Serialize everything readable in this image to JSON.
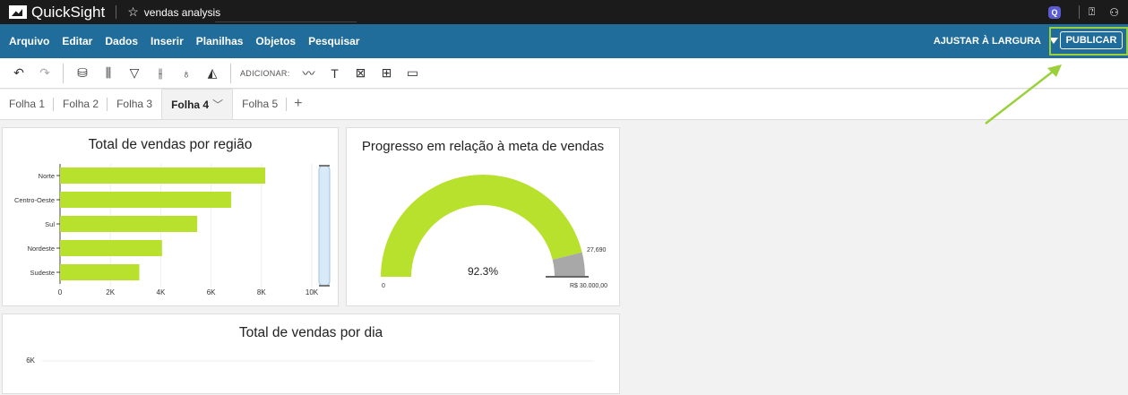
{
  "topbar": {
    "app_name": "QuickSight",
    "analysis_title": "vendas analysis",
    "q_icon": "Q",
    "help_icon": "help-icon",
    "user_icon": "user-icon"
  },
  "menubar": {
    "items": [
      "Arquivo",
      "Editar",
      "Dados",
      "Inserir",
      "Planilhas",
      "Objetos",
      "Pesquisar"
    ],
    "fit_label": "AJUSTAR À LARGURA",
    "publish_label": "PUBLICAR"
  },
  "toolbar": {
    "add_label": "ADICIONAR:"
  },
  "tabs": {
    "items": [
      "Folha 1",
      "Folha 2",
      "Folha 3",
      "Folha 4",
      "Folha 5"
    ],
    "active": "Folha 4"
  },
  "colors": {
    "accent_green": "#b7e12c",
    "menubar": "#206c9a",
    "topbar": "#1b1b1b",
    "gauge_remaining": "#a8a8a8"
  },
  "chart_region": {
    "title": "Total de vendas por região",
    "chart_data": {
      "type": "bar",
      "orientation": "horizontal",
      "categories": [
        "Norte",
        "Centro-Oeste",
        "Sul",
        "Nordeste",
        "Sudeste"
      ],
      "values": [
        8150,
        6800,
        5450,
        4050,
        3150
      ],
      "xlim": [
        0,
        10000
      ],
      "xticks": [
        "0",
        "2K",
        "4K",
        "6K",
        "8K",
        "10K"
      ],
      "grid": true
    }
  },
  "chart_gauge": {
    "title": "Progresso em relação à meta de vendas",
    "chart_data": {
      "type": "gauge",
      "value": 27690,
      "value_label": "27,690",
      "target": 30000,
      "target_label": "R$ 30.000,00",
      "min_label": "0",
      "percent_label": "92.3%"
    }
  },
  "chart_day": {
    "title": "Total de vendas por dia",
    "chart_data": {
      "type": "line",
      "yticks": [
        "6K"
      ]
    }
  }
}
